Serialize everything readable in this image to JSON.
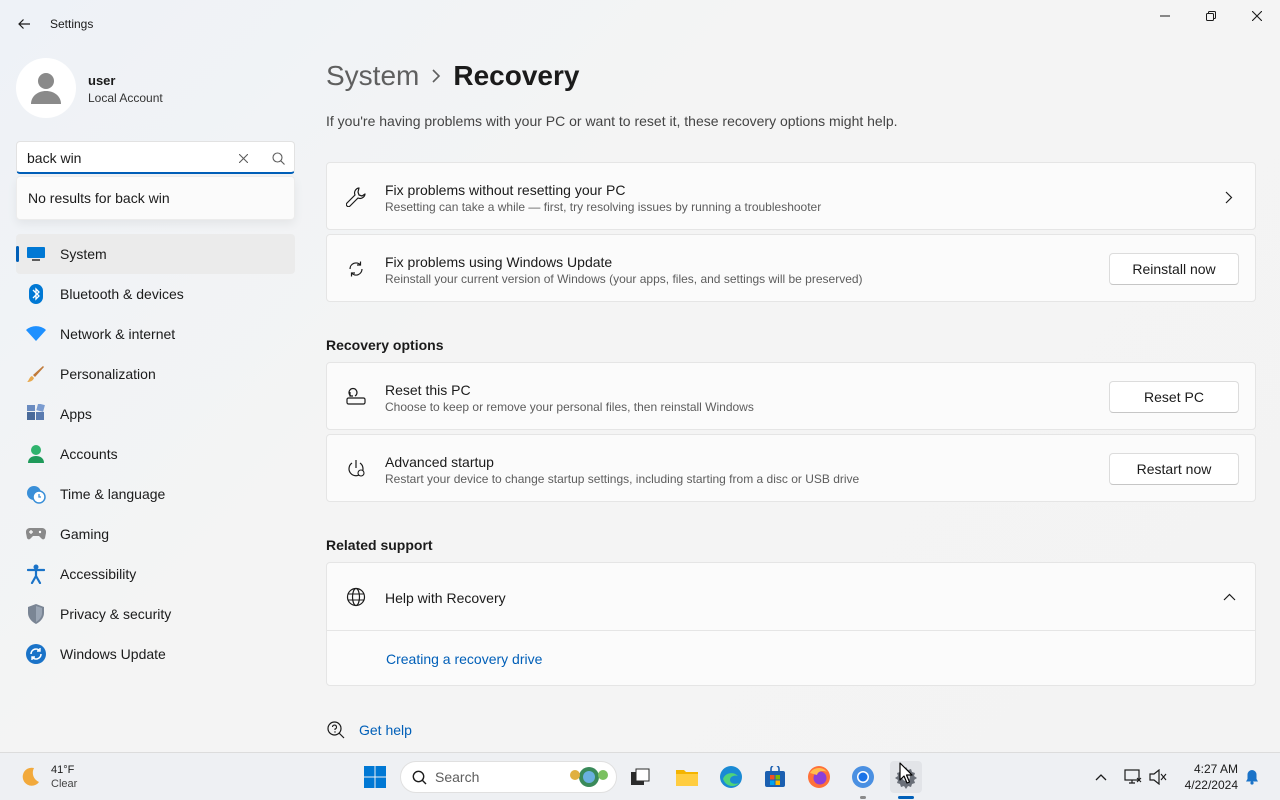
{
  "app": {
    "title": "Settings"
  },
  "user": {
    "name": "user",
    "type": "Local Account"
  },
  "search": {
    "value": "back win",
    "no_results": "No results for back win"
  },
  "sidebar": {
    "items": [
      {
        "label": "System",
        "icon": "system-icon",
        "selected": true
      },
      {
        "label": "Bluetooth & devices",
        "icon": "bluetooth-icon"
      },
      {
        "label": "Network & internet",
        "icon": "wifi-icon"
      },
      {
        "label": "Personalization",
        "icon": "brush-icon"
      },
      {
        "label": "Apps",
        "icon": "apps-icon"
      },
      {
        "label": "Accounts",
        "icon": "accounts-icon"
      },
      {
        "label": "Time & language",
        "icon": "clock-globe-icon"
      },
      {
        "label": "Gaming",
        "icon": "gamepad-icon"
      },
      {
        "label": "Accessibility",
        "icon": "accessibility-icon"
      },
      {
        "label": "Privacy & security",
        "icon": "shield-icon"
      },
      {
        "label": "Windows Update",
        "icon": "update-icon"
      }
    ]
  },
  "breadcrumb": {
    "parent": "System",
    "current": "Recovery"
  },
  "intro": "If you're having problems with your PC or want to reset it, these recovery options might help.",
  "cards": {
    "fix_without_reset": {
      "title": "Fix problems without resetting your PC",
      "desc": "Resetting can take a while — first, try resolving issues by running a troubleshooter"
    },
    "fix_windows_update": {
      "title": "Fix problems using Windows Update",
      "desc": "Reinstall your current version of Windows (your apps, files, and settings will be preserved)",
      "button": "Reinstall now"
    }
  },
  "recovery_options": {
    "heading": "Recovery options",
    "reset": {
      "title": "Reset this PC",
      "desc": "Choose to keep or remove your personal files, then reinstall Windows",
      "button": "Reset PC"
    },
    "advanced": {
      "title": "Advanced startup",
      "desc": "Restart your device to change startup settings, including starting from a disc or USB drive",
      "button": "Restart now"
    }
  },
  "related_support": {
    "heading": "Related support",
    "title": "Help with Recovery",
    "link": "Creating a recovery drive"
  },
  "get_help": "Get help",
  "taskbar": {
    "weather": {
      "temp": "41°F",
      "desc": "Clear"
    },
    "search_label": "Search",
    "time": "4:27 AM",
    "date": "4/22/2024"
  },
  "colors": {
    "accent": "#005fb8",
    "selected_bg": "#ebebeb",
    "card_bg": "#fbfbfb"
  }
}
